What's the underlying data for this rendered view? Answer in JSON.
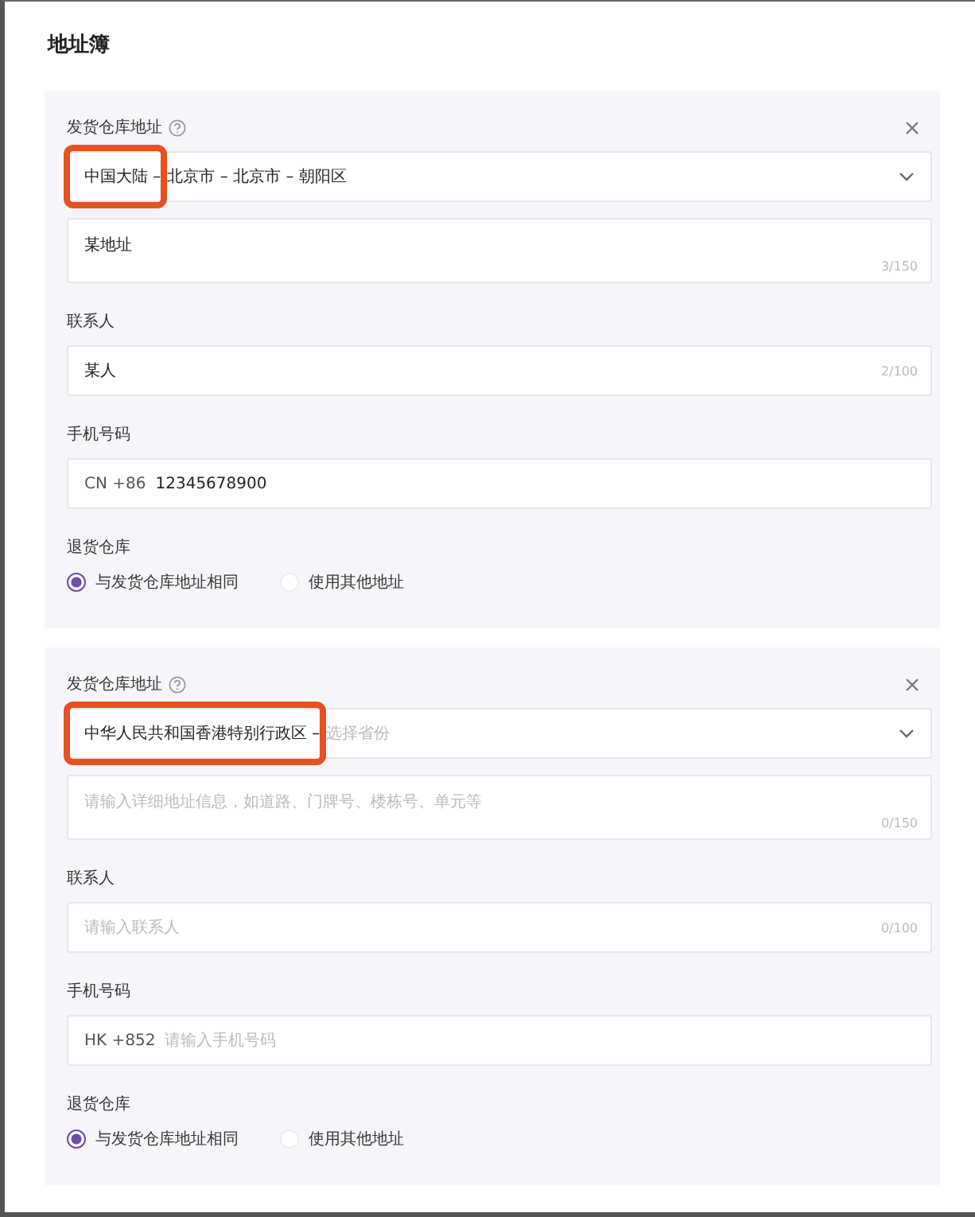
{
  "title": "地址簿",
  "cards": [
    {
      "region_label": "发货仓库地址",
      "region": {
        "parts": [
          {
            "text": "中国大陆 –",
            "highlighted": true
          },
          {
            "text": "北京市 – 北京市 – 朝阳区",
            "highlighted": false
          }
        ]
      },
      "address": {
        "value": "某地址",
        "counter": "3/150"
      },
      "contact_label": "联系人",
      "contact": {
        "value": "某人",
        "counter": "2/100"
      },
      "phone_label": "手机号码",
      "phone": {
        "prefix": "CN +86",
        "value": "12345678900"
      },
      "return_label": "退货仓库",
      "return_options": [
        {
          "label": "与发货仓库地址相同",
          "selected": true
        },
        {
          "label": "使用其他地址",
          "selected": false
        }
      ]
    },
    {
      "region_label": "发货仓库地址",
      "region": {
        "parts": [
          {
            "text": "中华人民共和国香港特别行政区 –",
            "highlighted": true
          }
        ],
        "placeholder": "选择省份"
      },
      "address": {
        "placeholder": "请输入详细地址信息，如道路、门牌号、楼栋号、单元等",
        "counter": "0/150"
      },
      "contact_label": "联系人",
      "contact": {
        "placeholder": "请输入联系人",
        "counter": "0/100"
      },
      "phone_label": "手机号码",
      "phone": {
        "prefix": "HK +852",
        "placeholder": "请输入手机号码"
      },
      "return_label": "退货仓库",
      "return_options": [
        {
          "label": "与发货仓库地址相同",
          "selected": true
        },
        {
          "label": "使用其他地址",
          "selected": false
        }
      ]
    }
  ]
}
